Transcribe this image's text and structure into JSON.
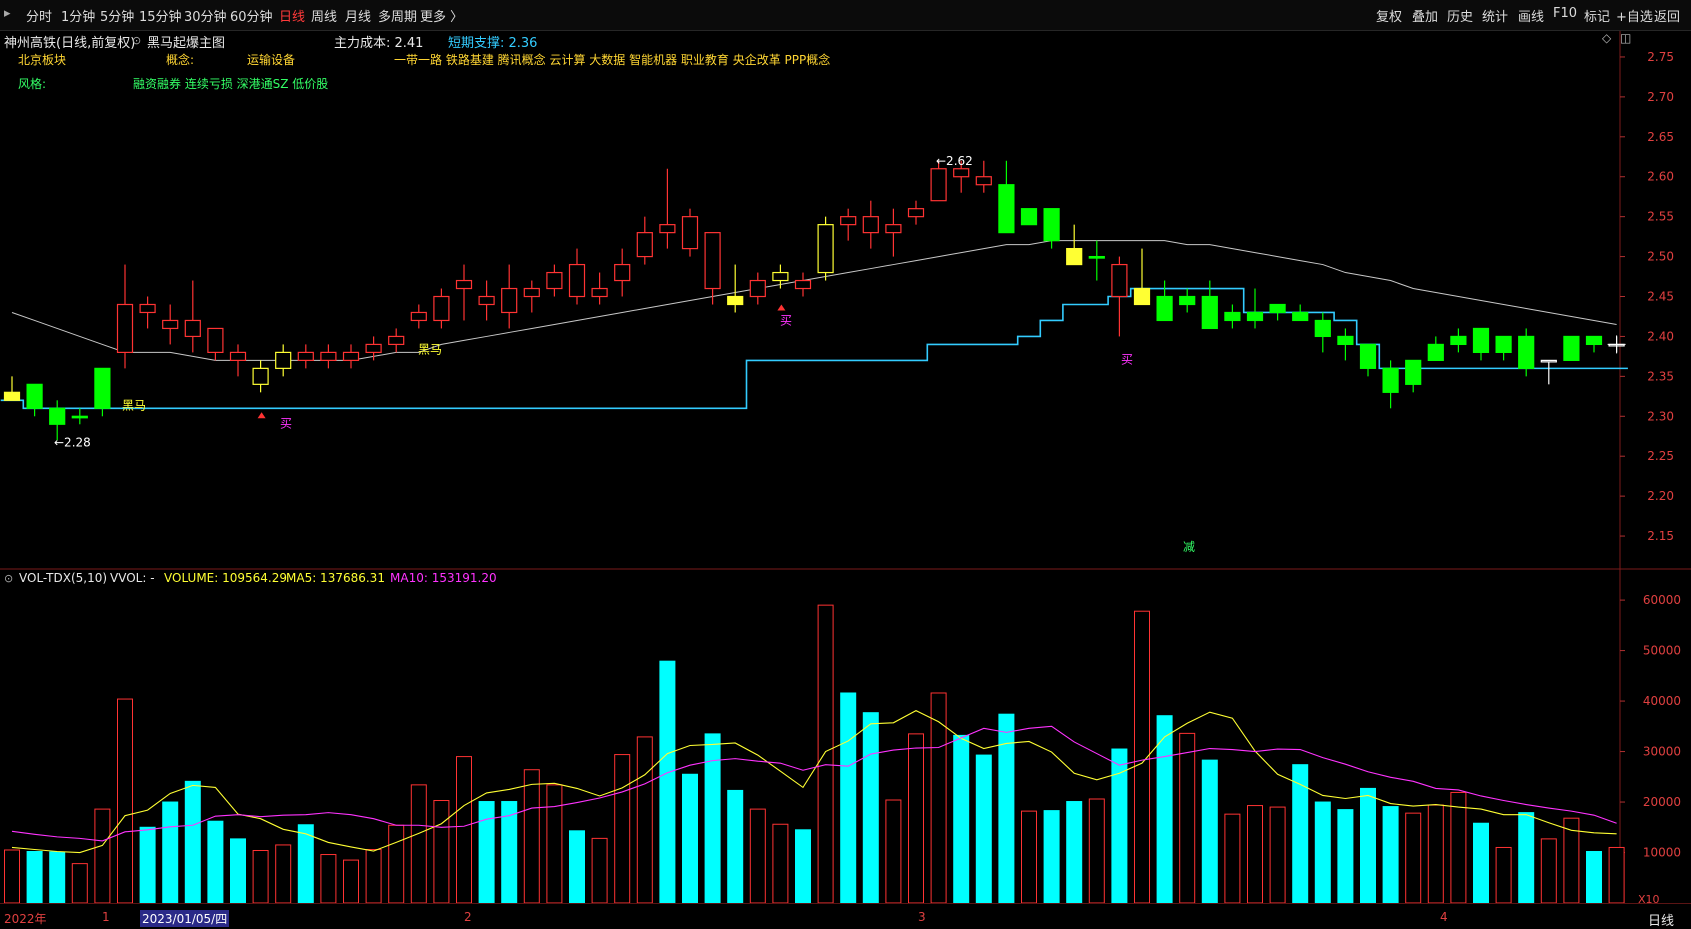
{
  "toolbar": {
    "periods": [
      "分时",
      "1分钟",
      "5分钟",
      "15分钟",
      "30分钟",
      "60分钟",
      "日线",
      "周线",
      "月线",
      "多周期",
      "更多 〉"
    ],
    "active_period": "日线",
    "right": [
      "复权",
      "叠加",
      "历史",
      "统计",
      "画线",
      "F10",
      "标记",
      "+自选",
      "返回"
    ]
  },
  "header": {
    "stock": "神州高铁(日线,前复权)",
    "indicator": "黑马起爆主图",
    "cost_label": "主力成本: 2.41",
    "support_label": "短期支撑: 2.36"
  },
  "tags": {
    "board_label": "北京板块",
    "concept_label": "概念:",
    "industry": "运输设备",
    "concepts": "一带一路 铁路基建 腾讯概念 云计算 大数据 智能机器 职业教育 央企改革 PPP概念",
    "style_label": "风格:",
    "styles": "融资融券 连续亏损 深港通SZ 低价股"
  },
  "markers": {
    "low_label": "←2.28",
    "high_label": "←2.62",
    "heima_1": "黑马",
    "heima_2": "黑马",
    "buy_1": "买",
    "buy_2": "买",
    "buy_3": "买",
    "sell": "减"
  },
  "volume_header": {
    "name": "VOL-TDX(5,10)",
    "vvol": "VVOL: -",
    "volume": "VOLUME: 109564.29",
    "ma5": "MA5: 137686.31",
    "ma10": "MA10: 153191.20",
    "unit": "X10"
  },
  "xaxis": {
    "labels": [
      "2022年",
      "1",
      "2023/01/05/四",
      "2",
      "3",
      "4"
    ],
    "right": "日线"
  },
  "colors": {
    "up": "#ff3333",
    "down_price": "#00ff00",
    "down_vol": "#00ffff",
    "yellow": "#ffff33",
    "support": "#33ccff",
    "ma": "#c8c8c8",
    "ma10": "#ff33ff"
  },
  "chart_data": [
    {
      "type": "candlestick",
      "title": "",
      "y_ticks": [
        2.15,
        2.2,
        2.25,
        2.3,
        2.35,
        2.4,
        2.45,
        2.5,
        2.55,
        2.6,
        2.65,
        2.7,
        2.75
      ],
      "ylim": [
        2.11,
        2.78
      ],
      "candles": [
        {
          "o": 2.33,
          "h": 2.35,
          "l": 2.32,
          "c": 2.32,
          "k": "y"
        },
        {
          "o": 2.34,
          "h": 2.34,
          "l": 2.3,
          "c": 2.31,
          "k": "g"
        },
        {
          "o": 2.31,
          "h": 2.32,
          "l": 2.27,
          "c": 2.29,
          "k": "g"
        },
        {
          "o": 2.3,
          "h": 2.31,
          "l": 2.29,
          "c": 2.3,
          "k": "g"
        },
        {
          "o": 2.31,
          "h": 2.36,
          "l": 2.3,
          "c": 2.36,
          "k": "g"
        },
        {
          "o": 2.38,
          "h": 2.49,
          "l": 2.36,
          "c": 2.44,
          "k": "r"
        },
        {
          "o": 2.43,
          "h": 2.45,
          "l": 2.41,
          "c": 2.44,
          "k": "r"
        },
        {
          "o": 2.42,
          "h": 2.44,
          "l": 2.39,
          "c": 2.41,
          "k": "r"
        },
        {
          "o": 2.4,
          "h": 2.47,
          "l": 2.38,
          "c": 2.42,
          "k": "r"
        },
        {
          "o": 2.38,
          "h": 2.41,
          "l": 2.37,
          "c": 2.41,
          "k": "r"
        },
        {
          "o": 2.37,
          "h": 2.39,
          "l": 2.35,
          "c": 2.38,
          "k": "r"
        },
        {
          "o": 2.34,
          "h": 2.37,
          "l": 2.33,
          "c": 2.36,
          "k": "y"
        },
        {
          "o": 2.36,
          "h": 2.39,
          "l": 2.35,
          "c": 2.38,
          "k": "y"
        },
        {
          "o": 2.37,
          "h": 2.39,
          "l": 2.36,
          "c": 2.38,
          "k": "r"
        },
        {
          "o": 2.37,
          "h": 2.39,
          "l": 2.36,
          "c": 2.38,
          "k": "r"
        },
        {
          "o": 2.37,
          "h": 2.39,
          "l": 2.36,
          "c": 2.38,
          "k": "r"
        },
        {
          "o": 2.38,
          "h": 2.4,
          "l": 2.37,
          "c": 2.39,
          "k": "r"
        },
        {
          "o": 2.39,
          "h": 2.41,
          "l": 2.38,
          "c": 2.4,
          "k": "r"
        },
        {
          "o": 2.42,
          "h": 2.44,
          "l": 2.41,
          "c": 2.43,
          "k": "r"
        },
        {
          "o": 2.42,
          "h": 2.46,
          "l": 2.41,
          "c": 2.45,
          "k": "r"
        },
        {
          "o": 2.46,
          "h": 2.49,
          "l": 2.42,
          "c": 2.47,
          "k": "r"
        },
        {
          "o": 2.44,
          "h": 2.47,
          "l": 2.42,
          "c": 2.45,
          "k": "r"
        },
        {
          "o": 2.46,
          "h": 2.49,
          "l": 2.41,
          "c": 2.43,
          "k": "r"
        },
        {
          "o": 2.45,
          "h": 2.47,
          "l": 2.43,
          "c": 2.46,
          "k": "r"
        },
        {
          "o": 2.46,
          "h": 2.49,
          "l": 2.45,
          "c": 2.48,
          "k": "r"
        },
        {
          "o": 2.49,
          "h": 2.51,
          "l": 2.44,
          "c": 2.45,
          "k": "r"
        },
        {
          "o": 2.45,
          "h": 2.48,
          "l": 2.44,
          "c": 2.46,
          "k": "r"
        },
        {
          "o": 2.47,
          "h": 2.51,
          "l": 2.45,
          "c": 2.49,
          "k": "r"
        },
        {
          "o": 2.5,
          "h": 2.55,
          "l": 2.49,
          "c": 2.53,
          "k": "r"
        },
        {
          "o": 2.53,
          "h": 2.61,
          "l": 2.51,
          "c": 2.54,
          "k": "r"
        },
        {
          "o": 2.55,
          "h": 2.56,
          "l": 2.5,
          "c": 2.51,
          "k": "r"
        },
        {
          "o": 2.53,
          "h": 2.53,
          "l": 2.44,
          "c": 2.46,
          "k": "r"
        },
        {
          "o": 2.45,
          "h": 2.49,
          "l": 2.43,
          "c": 2.44,
          "k": "y"
        },
        {
          "o": 2.45,
          "h": 2.48,
          "l": 2.44,
          "c": 2.47,
          "k": "r"
        },
        {
          "o": 2.47,
          "h": 2.49,
          "l": 2.46,
          "c": 2.48,
          "k": "y"
        },
        {
          "o": 2.46,
          "h": 2.48,
          "l": 2.45,
          "c": 2.47,
          "k": "r"
        },
        {
          "o": 2.48,
          "h": 2.55,
          "l": 2.47,
          "c": 2.54,
          "k": "y"
        },
        {
          "o": 2.54,
          "h": 2.56,
          "l": 2.52,
          "c": 2.55,
          "k": "r"
        },
        {
          "o": 2.53,
          "h": 2.57,
          "l": 2.51,
          "c": 2.55,
          "k": "r"
        },
        {
          "o": 2.53,
          "h": 2.56,
          "l": 2.5,
          "c": 2.54,
          "k": "r"
        },
        {
          "o": 2.55,
          "h": 2.57,
          "l": 2.54,
          "c": 2.56,
          "k": "r"
        },
        {
          "o": 2.57,
          "h": 2.62,
          "l": 2.57,
          "c": 2.61,
          "k": "r"
        },
        {
          "o": 2.6,
          "h": 2.62,
          "l": 2.58,
          "c": 2.61,
          "k": "r"
        },
        {
          "o": 2.59,
          "h": 2.62,
          "l": 2.58,
          "c": 2.6,
          "k": "r"
        },
        {
          "o": 2.59,
          "h": 2.62,
          "l": 2.53,
          "c": 2.53,
          "k": "g"
        },
        {
          "o": 2.56,
          "h": 2.56,
          "l": 2.54,
          "c": 2.54,
          "k": "g"
        },
        {
          "o": 2.56,
          "h": 2.56,
          "l": 2.51,
          "c": 2.52,
          "k": "g"
        },
        {
          "o": 2.51,
          "h": 2.54,
          "l": 2.49,
          "c": 2.49,
          "k": "y"
        },
        {
          "o": 2.5,
          "h": 2.52,
          "l": 2.47,
          "c": 2.5,
          "k": "g"
        },
        {
          "o": 2.45,
          "h": 2.5,
          "l": 2.4,
          "c": 2.49,
          "k": "r"
        },
        {
          "o": 2.46,
          "h": 2.51,
          "l": 2.45,
          "c": 2.44,
          "k": "y"
        },
        {
          "o": 2.45,
          "h": 2.47,
          "l": 2.42,
          "c": 2.42,
          "k": "g"
        },
        {
          "o": 2.45,
          "h": 2.46,
          "l": 2.43,
          "c": 2.44,
          "k": "g"
        },
        {
          "o": 2.45,
          "h": 2.47,
          "l": 2.41,
          "c": 2.41,
          "k": "g"
        },
        {
          "o": 2.43,
          "h": 2.44,
          "l": 2.41,
          "c": 2.42,
          "k": "g"
        },
        {
          "o": 2.43,
          "h": 2.46,
          "l": 2.41,
          "c": 2.42,
          "k": "g"
        },
        {
          "o": 2.44,
          "h": 2.44,
          "l": 2.42,
          "c": 2.43,
          "k": "g"
        },
        {
          "o": 2.43,
          "h": 2.44,
          "l": 2.42,
          "c": 2.42,
          "k": "g"
        },
        {
          "o": 2.42,
          "h": 2.43,
          "l": 2.38,
          "c": 2.4,
          "k": "g"
        },
        {
          "o": 2.4,
          "h": 2.41,
          "l": 2.37,
          "c": 2.39,
          "k": "g"
        },
        {
          "o": 2.39,
          "h": 2.39,
          "l": 2.35,
          "c": 2.36,
          "k": "g"
        },
        {
          "o": 2.36,
          "h": 2.37,
          "l": 2.31,
          "c": 2.33,
          "k": "g"
        },
        {
          "o": 2.37,
          "h": 2.37,
          "l": 2.33,
          "c": 2.34,
          "k": "g"
        },
        {
          "o": 2.39,
          "h": 2.4,
          "l": 2.37,
          "c": 2.37,
          "k": "g"
        },
        {
          "o": 2.4,
          "h": 2.41,
          "l": 2.38,
          "c": 2.39,
          "k": "g"
        },
        {
          "o": 2.41,
          "h": 2.41,
          "l": 2.37,
          "c": 2.38,
          "k": "g"
        },
        {
          "o": 2.4,
          "h": 2.4,
          "l": 2.37,
          "c": 2.38,
          "k": "g"
        },
        {
          "o": 2.4,
          "h": 2.41,
          "l": 2.35,
          "c": 2.36,
          "k": "g"
        },
        {
          "o": 2.37,
          "h": 2.37,
          "l": 2.34,
          "c": 2.37,
          "k": "w"
        },
        {
          "o": 2.4,
          "h": 2.4,
          "l": 2.37,
          "c": 2.37,
          "k": "g"
        },
        {
          "o": 2.4,
          "h": 2.4,
          "l": 2.38,
          "c": 2.39,
          "k": "g"
        },
        {
          "o": 2.39,
          "h": 2.4,
          "l": 2.38,
          "c": 2.39,
          "k": "w"
        }
      ],
      "ma_line": [
        2.43,
        2.42,
        2.41,
        2.4,
        2.39,
        2.38,
        2.38,
        2.38,
        2.375,
        2.37,
        2.37,
        2.37,
        2.37,
        2.37,
        2.37,
        2.37,
        2.375,
        2.38,
        2.38,
        2.39,
        2.395,
        2.4,
        2.405,
        2.41,
        2.415,
        2.42,
        2.425,
        2.43,
        2.435,
        2.44,
        2.445,
        2.45,
        2.455,
        2.46,
        2.465,
        2.47,
        2.475,
        2.48,
        2.485,
        2.49,
        2.495,
        2.5,
        2.505,
        2.51,
        2.515,
        2.515,
        2.52,
        2.52,
        2.52,
        2.52,
        2.52,
        2.52,
        2.515,
        2.515,
        2.51,
        2.505,
        2.5,
        2.495,
        2.49,
        2.48,
        2.475,
        2.47,
        2.46,
        2.455,
        2.45,
        2.445,
        2.44,
        2.435,
        2.43,
        2.425,
        2.42,
        2.415
      ],
      "support_line": [
        2.32,
        2.31,
        2.31,
        2.31,
        2.31,
        2.31,
        2.31,
        2.31,
        2.31,
        2.31,
        2.31,
        2.31,
        2.31,
        2.31,
        2.31,
        2.31,
        2.31,
        2.31,
        2.31,
        2.31,
        2.31,
        2.31,
        2.31,
        2.31,
        2.31,
        2.31,
        2.31,
        2.31,
        2.31,
        2.31,
        2.31,
        2.31,
        2.31,
        2.37,
        2.37,
        2.37,
        2.37,
        2.37,
        2.37,
        2.37,
        2.37,
        2.39,
        2.39,
        2.39,
        2.39,
        2.4,
        2.42,
        2.44,
        2.44,
        2.45,
        2.46,
        2.46,
        2.46,
        2.46,
        2.46,
        2.43,
        2.43,
        2.43,
        2.43,
        2.42,
        2.39,
        2.36,
        2.36,
        2.36,
        2.36,
        2.36,
        2.36,
        2.36,
        2.36,
        2.36,
        2.36,
        2.36
      ]
    },
    {
      "type": "bar",
      "title": "",
      "y_ticks": [
        10000,
        20000,
        30000,
        40000,
        50000,
        60000
      ],
      "ylim": [
        0,
        62000
      ],
      "volumes": [
        10500,
        10200,
        10100,
        7800,
        18600,
        40400,
        15000,
        20000,
        24100,
        16200,
        12700,
        10400,
        11500,
        15500,
        9600,
        8500,
        10600,
        15400,
        23400,
        20300,
        29000,
        20100,
        20100,
        26400,
        23400,
        14300,
        12800,
        29400,
        32900,
        47900,
        25500,
        33500,
        22300,
        18600,
        15600,
        14500,
        59000,
        41600,
        37700,
        20400,
        33500,
        41600,
        33200,
        29300,
        37400,
        18200,
        18300,
        20100,
        20600,
        30500,
        57800,
        37100,
        33600,
        28300,
        17600,
        19300,
        19000,
        27400,
        20000,
        18500,
        22700,
        19100,
        17800,
        19400,
        21900,
        15800,
        11000,
        17900,
        12700,
        16800,
        10200,
        11000
      ],
      "vol_up": [
        1,
        0,
        0,
        1,
        1,
        1,
        0,
        0,
        0,
        0,
        0,
        1,
        1,
        0,
        1,
        1,
        1,
        1,
        1,
        1,
        1,
        0,
        0,
        1,
        1,
        0,
        1,
        1,
        1,
        0,
        0,
        0,
        0,
        1,
        1,
        0,
        1,
        0,
        0,
        1,
        1,
        1,
        0,
        0,
        0,
        1,
        0,
        0,
        1,
        0,
        1,
        0,
        1,
        0,
        1,
        1,
        1,
        0,
        0,
        0,
        0,
        0,
        1,
        1,
        1,
        0,
        1,
        0,
        1,
        1,
        0,
        1
      ],
      "ma5": [
        11000,
        10600,
        10200,
        10000,
        11400,
        17300,
        18400,
        21700,
        23300,
        22900,
        17600,
        16700,
        14600,
        13700,
        12000,
        11100,
        10300,
        12000,
        13800,
        15700,
        19300,
        21800,
        22500,
        23500,
        23700,
        22700,
        21200,
        22800,
        25400,
        29600,
        31200,
        31400,
        31700,
        29300,
        26100,
        22900,
        30000,
        32100,
        35500,
        35700,
        38100,
        35900,
        32600,
        30600,
        31600,
        32000,
        29900,
        25700,
        24400,
        25700,
        27700,
        32900,
        35600,
        37800,
        36600,
        30100,
        25500,
        23500,
        21300,
        20700,
        21300,
        19700,
        19200,
        19500,
        19000,
        18600,
        17500,
        17500,
        15900,
        14400,
        13900,
        13700
      ],
      "ma10": [
        14200,
        13600,
        13100,
        12800,
        12300,
        14100,
        14500,
        15100,
        15400,
        17200,
        17500,
        17100,
        17400,
        17500,
        17900,
        17500,
        16700,
        15400,
        15400,
        15000,
        15200,
        16600,
        17300,
        18800,
        19100,
        19900,
        20800,
        22000,
        23600,
        25800,
        27300,
        28200,
        28600,
        28100,
        27700,
        26300,
        27400,
        27100,
        29500,
        30300,
        30700,
        30800,
        32700,
        34600,
        33800,
        34600,
        35000,
        31900,
        29600,
        27300,
        28300,
        29000,
        29800,
        30600,
        30400,
        30000,
        30500,
        30400,
        28800,
        27500,
        26000,
        24900,
        24100,
        22700,
        22400,
        21200,
        20300,
        19500,
        18800,
        18200,
        17400,
        15800
      ]
    }
  ]
}
